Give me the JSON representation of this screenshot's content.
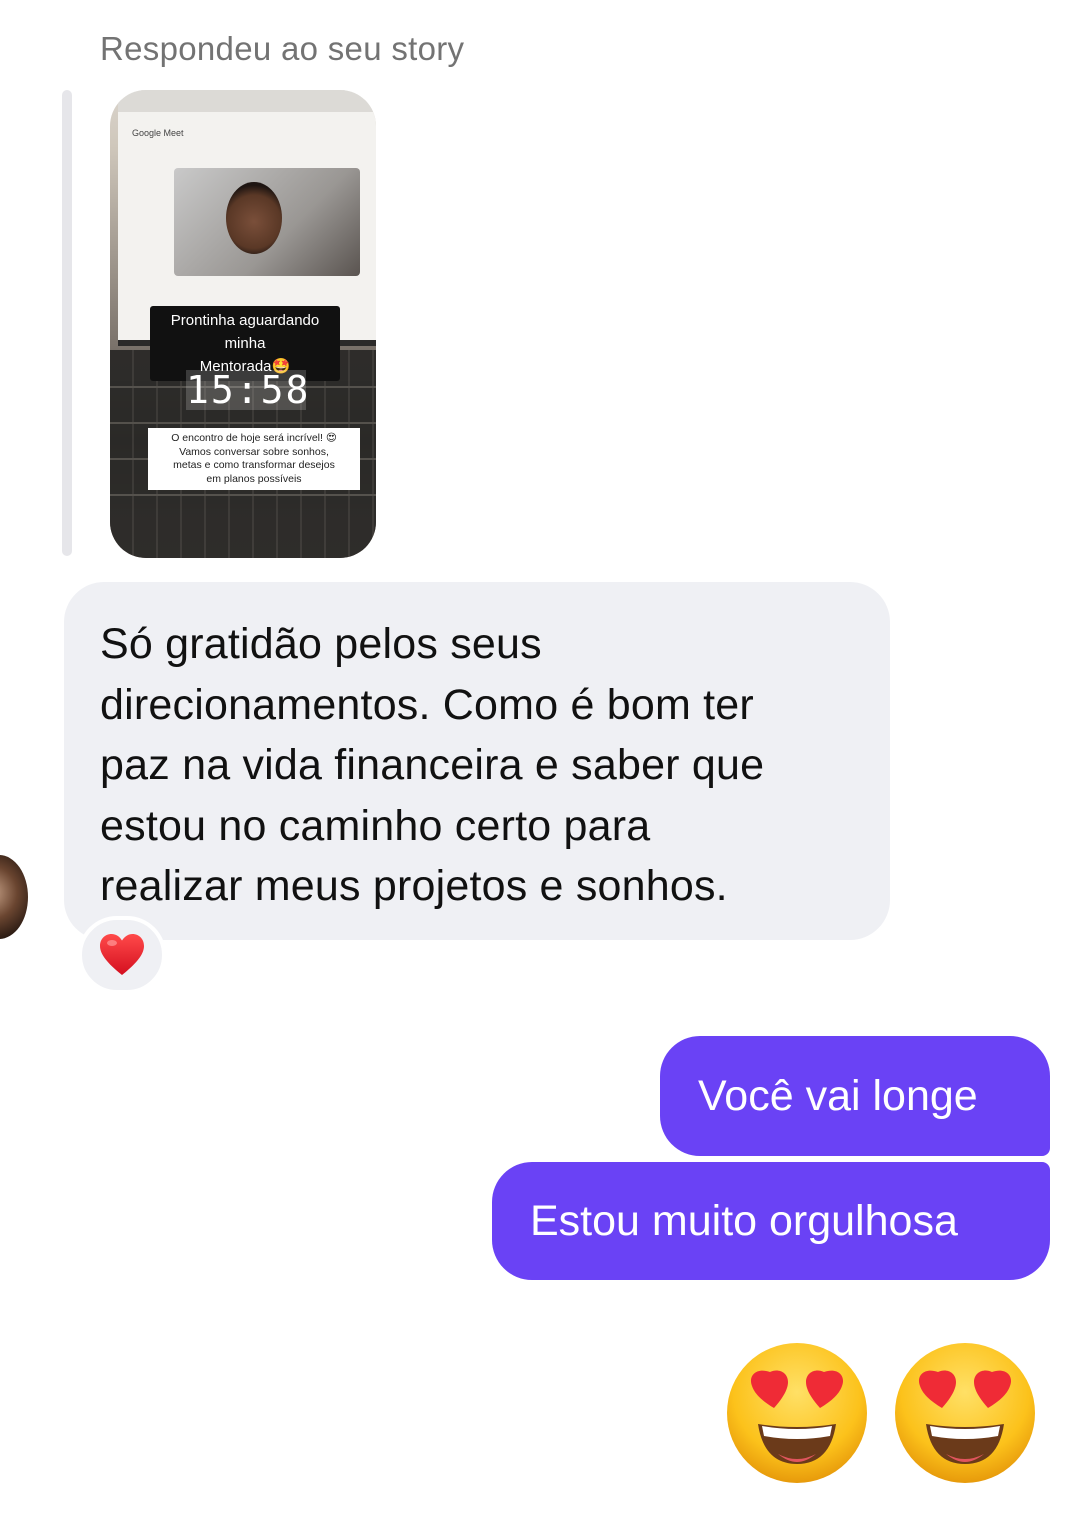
{
  "reply_header": {
    "label": "Respondeu ao seu story"
  },
  "story": {
    "app_label": "Google Meet",
    "caption_lines": [
      "Prontinha aguardando minha",
      "Mentorada🤩"
    ],
    "clock": "15:58",
    "note_lines": [
      "O encontro de hoje será incrível! 😍",
      "Vamos conversar sobre sonhos,",
      "metas e como transformar desejos",
      "em planos possíveis"
    ]
  },
  "incoming_message": {
    "lines": [
      "Só gratidão pelos seus",
      "direcionamentos. Como é bom ter",
      "paz na vida financeira e saber que",
      "estou no caminho certo para",
      "realizar meus projetos e sonhos."
    ],
    "reaction_icon": "red-heart-icon"
  },
  "outgoing_messages": [
    {
      "text": "Você vai longe"
    },
    {
      "text": "Estou muito orgulhosa"
    }
  ],
  "emoji_reply": {
    "icons": [
      "heart-eyes-emoji",
      "heart-eyes-emoji"
    ]
  },
  "colors": {
    "outgoing_bubble": "#6a42f5",
    "incoming_bubble": "#eff0f4",
    "reply_label": "#737373"
  }
}
